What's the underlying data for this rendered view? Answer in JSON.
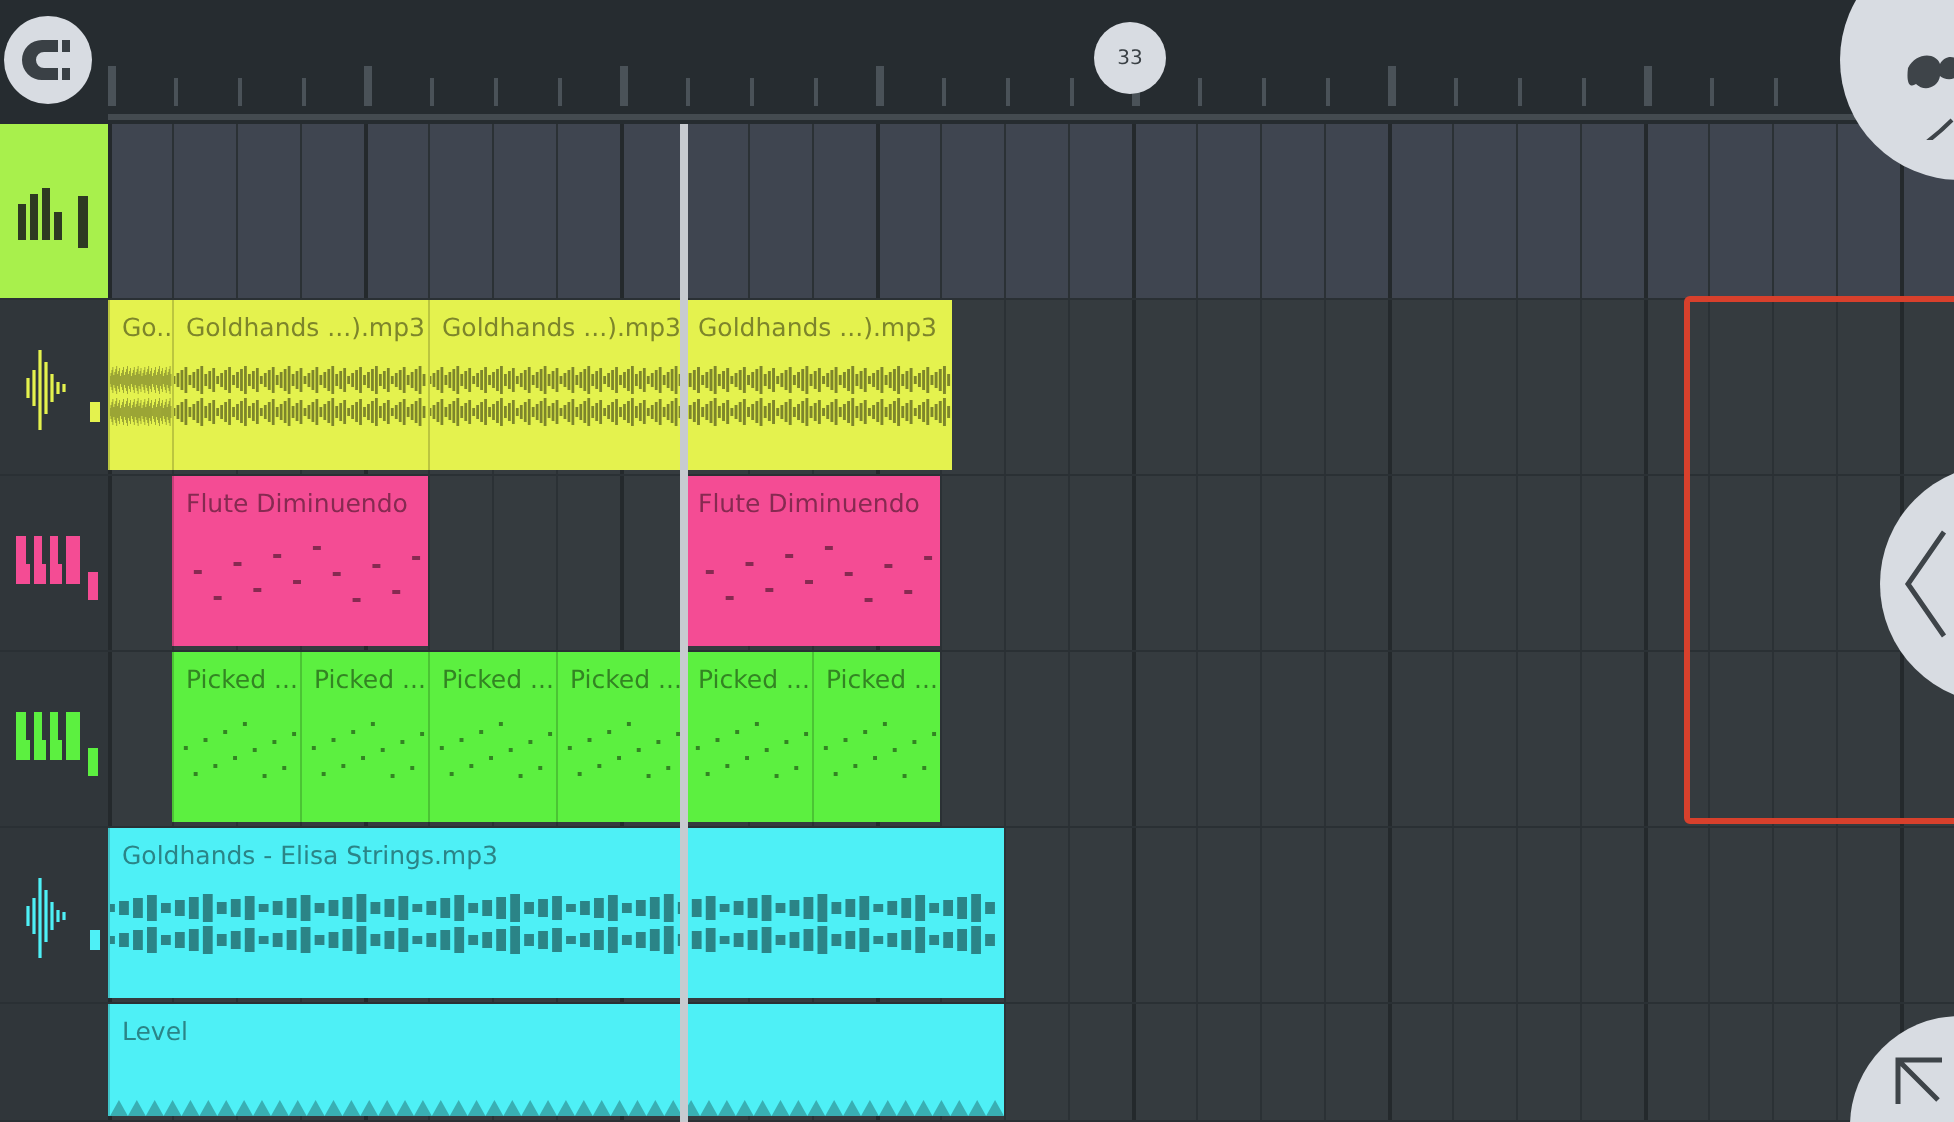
{
  "ruler": {
    "marker": "33"
  },
  "tracks": [
    {
      "kind": "automation",
      "selected": true,
      "color": "#a8f04c"
    },
    {
      "kind": "audio",
      "selected": false,
      "color": "#e4f24e",
      "clips": [
        {
          "label": "Go..."
        },
        {
          "label": "Goldhands ...).mp3"
        },
        {
          "label": "Goldhands ...).mp3"
        },
        {
          "label": "Goldhands ...).mp3"
        }
      ]
    },
    {
      "kind": "pattern",
      "selected": false,
      "color": "#f44c94",
      "clips": [
        {
          "label": "Flute Diminuendo"
        },
        {
          "label": "Flute Diminuendo"
        }
      ]
    },
    {
      "kind": "pattern",
      "selected": false,
      "color": "#5cf040",
      "clips": [
        {
          "label": "Picked ..."
        },
        {
          "label": "Picked ..."
        },
        {
          "label": "Picked ..."
        },
        {
          "label": "Picked ..."
        },
        {
          "label": "Picked ..."
        },
        {
          "label": "Picked ..."
        }
      ]
    },
    {
      "kind": "audio",
      "selected": false,
      "color": "#4ef0f6",
      "clips": [
        {
          "label": "Goldhands - Elisa Strings.mp3"
        }
      ]
    },
    {
      "kind": "level",
      "selected": false,
      "color": "#4ef0f6",
      "clips": [
        {
          "label": "Level"
        }
      ]
    }
  ]
}
